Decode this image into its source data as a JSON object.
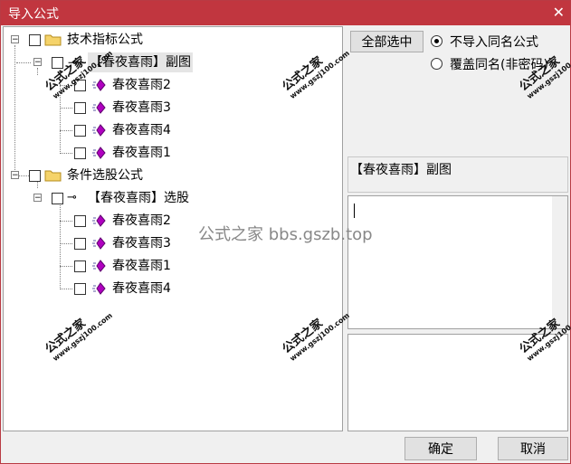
{
  "window": {
    "title": "导入公式",
    "close_glyph": "✕"
  },
  "tree": {
    "groups": [
      {
        "label": "技术指标公式",
        "items": [
          {
            "label": "【春夜喜雨】副图",
            "children": [
              "春夜喜雨2",
              "春夜喜雨3",
              "春夜喜雨4",
              "春夜喜雨1"
            ]
          }
        ]
      },
      {
        "label": "条件选股公式",
        "items": [
          {
            "label": "【春夜喜雨】选股",
            "children": [
              "春夜喜雨2",
              "春夜喜雨3",
              "春夜喜雨1",
              "春夜喜雨4"
            ]
          }
        ]
      }
    ]
  },
  "options": {
    "select_all_label": "全部选中",
    "radio_skip_label": "不导入同名公式",
    "radio_overwrite_label": "覆盖同名(非密码)"
  },
  "info_label": "【春夜喜雨】副图",
  "buttons": {
    "ok": "确定",
    "cancel": "取消"
  },
  "watermark": {
    "cn": "公式之家",
    "url": "www.gszj100.com",
    "center": "公式之家 bbs.gszb.top"
  },
  "colors": {
    "titlebar": "#c1363f",
    "formula_icon": "#b000c0",
    "folder": "#f5d36a"
  }
}
